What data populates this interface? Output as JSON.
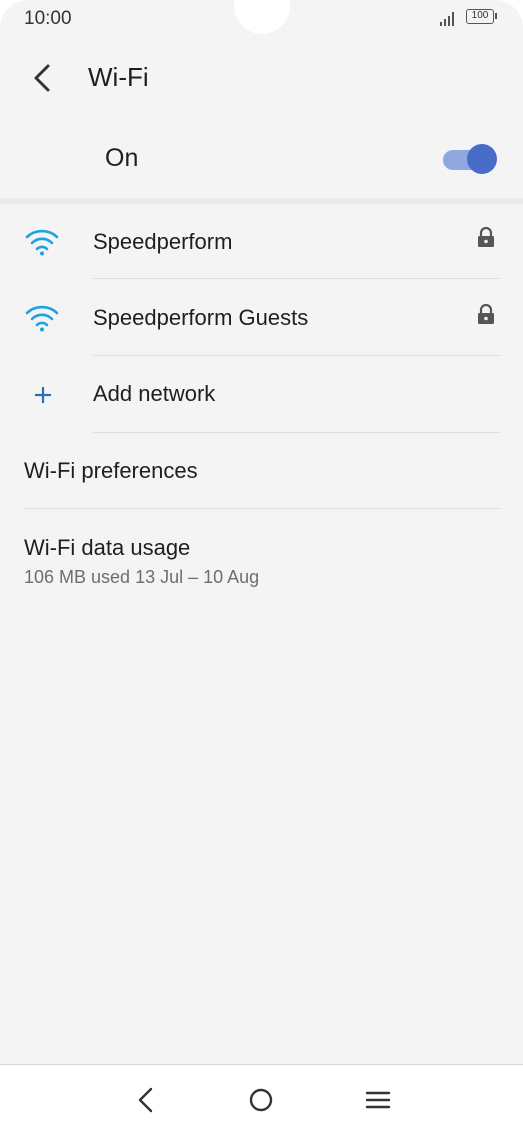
{
  "status_bar": {
    "time": "10:00",
    "battery_level": "100"
  },
  "header": {
    "title": "Wi-Fi",
    "back_icon": "back-arrow-icon"
  },
  "wifi_toggle": {
    "label": "On",
    "state": true
  },
  "networks": [
    {
      "name": "Speedperform",
      "icon": "wifi-signal-icon",
      "secured": true
    },
    {
      "name": "Speedperform Guests",
      "icon": "wifi-signal-icon",
      "secured": true
    }
  ],
  "add_network": {
    "label": "Add network",
    "icon": "plus-icon"
  },
  "preferences": {
    "label": "Wi-Fi preferences"
  },
  "data_usage": {
    "label": "Wi-Fi data usage",
    "summary": "106 MB used 13 Jul – 10 Aug"
  },
  "colors": {
    "accent": "#4a6cc9",
    "wifi_icon": "#1ea2e0",
    "add_icon": "#2a6fb5"
  },
  "nav_bar": {
    "icons": [
      "nav-back-icon",
      "nav-home-icon",
      "nav-menu-icon"
    ]
  }
}
